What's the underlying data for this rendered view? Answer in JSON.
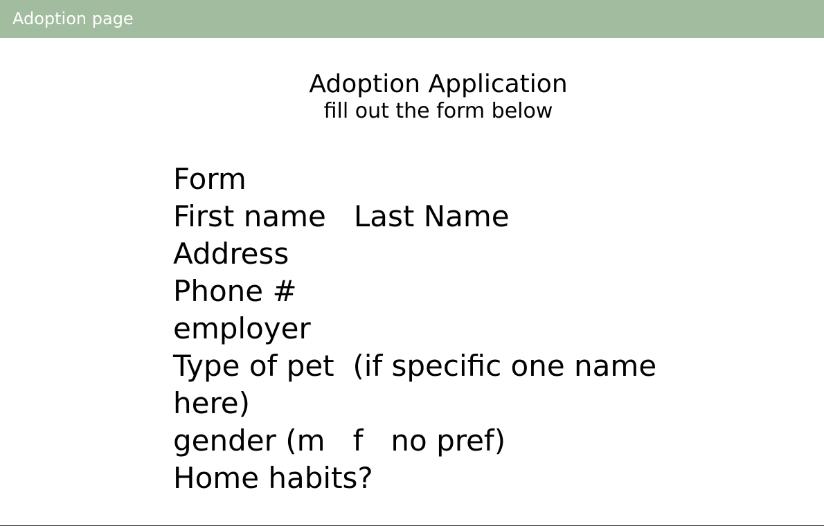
{
  "top_bar": {
    "title": "Adoption page",
    "color": "#a1bc9e"
  },
  "header": {
    "title": "Adoption Application",
    "subtitle": "fill out the form below"
  },
  "form": {
    "heading": "Form",
    "name_line": "First name   Last Name",
    "address_label": "Address",
    "phone_label": "Phone #",
    "employer_label": "employer",
    "pet_type_line_1": "Type of pet  (if specific one name",
    "pet_type_line_2": "here)",
    "gender_line": "gender (m   f   no pref)",
    "home_habits_label": "Home habits?"
  }
}
